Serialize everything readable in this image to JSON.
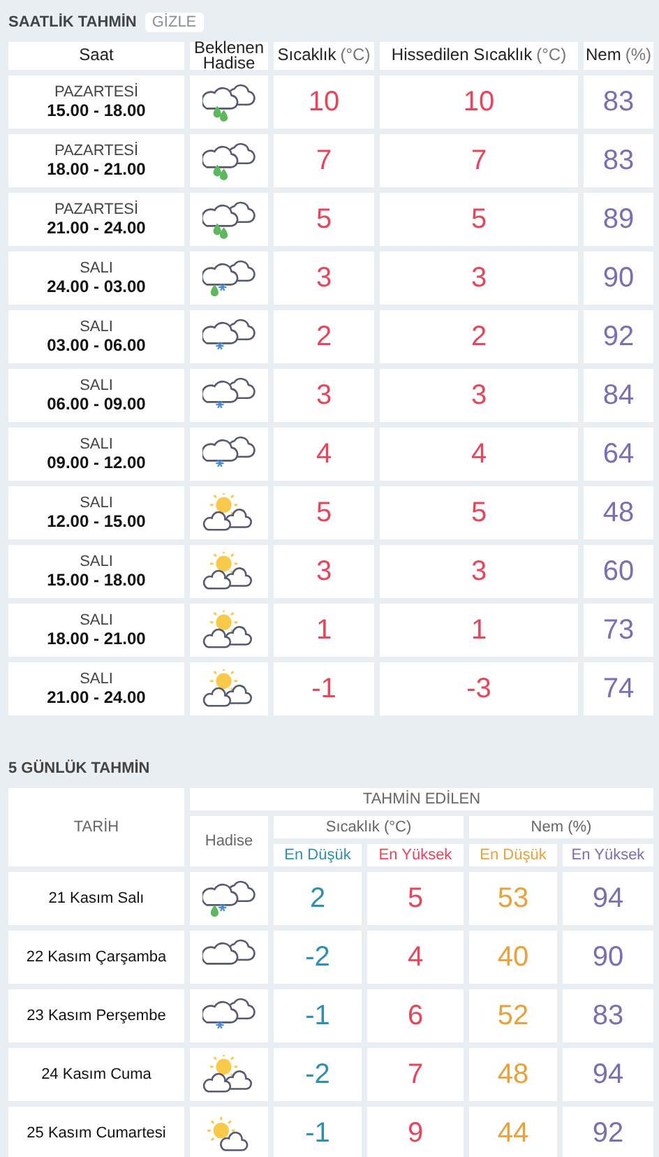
{
  "hourly": {
    "title": "SAATLİK TAHMİN",
    "hide_button": "GİZLE",
    "columns": [
      {
        "label": "Saat"
      },
      {
        "label": "Beklenen Hadise"
      },
      {
        "label": "Sıcaklık",
        "unit": "(°C)"
      },
      {
        "label": "Hissedilen Sıcaklık",
        "unit": "(°C)"
      },
      {
        "label": "Nem",
        "unit": "(%)"
      }
    ],
    "rows": [
      {
        "day": "PAZARTESİ",
        "time": "15.00 - 18.00",
        "kind": "rain",
        "temp": "10",
        "feels": "10",
        "humidity": "83"
      },
      {
        "day": "PAZARTESİ",
        "time": "18.00 - 21.00",
        "kind": "rain",
        "temp": "7",
        "feels": "7",
        "humidity": "83"
      },
      {
        "day": "PAZARTESİ",
        "time": "21.00 - 24.00",
        "kind": "rain",
        "temp": "5",
        "feels": "5",
        "humidity": "89"
      },
      {
        "day": "SALI",
        "time": "24.00 - 03.00",
        "kind": "sleet",
        "temp": "3",
        "feels": "3",
        "humidity": "90"
      },
      {
        "day": "SALI",
        "time": "03.00 - 06.00",
        "kind": "snow",
        "temp": "2",
        "feels": "2",
        "humidity": "92"
      },
      {
        "day": "SALI",
        "time": "06.00 - 09.00",
        "kind": "snow",
        "temp": "3",
        "feels": "3",
        "humidity": "84"
      },
      {
        "day": "SALI",
        "time": "09.00 - 12.00",
        "kind": "snow",
        "temp": "4",
        "feels": "4",
        "humidity": "64"
      },
      {
        "day": "SALI",
        "time": "12.00 - 15.00",
        "kind": "suncloud",
        "temp": "5",
        "feels": "5",
        "humidity": "48"
      },
      {
        "day": "SALI",
        "time": "15.00 - 18.00",
        "kind": "suncloud",
        "temp": "3",
        "feels": "3",
        "humidity": "60"
      },
      {
        "day": "SALI",
        "time": "18.00 - 21.00",
        "kind": "suncloud",
        "temp": "1",
        "feels": "1",
        "humidity": "73"
      },
      {
        "day": "SALI",
        "time": "21.00 - 24.00",
        "kind": "suncloud",
        "temp": "-1",
        "feels": "-3",
        "humidity": "74"
      }
    ]
  },
  "daily": {
    "title": "5 GÜNLÜK TAHMİN",
    "date_header": "TARİH",
    "group_header": "TAHMİN EDİLEN",
    "icon_header": "Hadise",
    "groups": [
      {
        "label": "Sıcaklık (°C)",
        "columns": [
          {
            "label": "En Düşük",
            "color": "#2f8fb3"
          },
          {
            "label": "En Yüksek",
            "color": "#e8445a"
          }
        ]
      },
      {
        "label": "Nem (%)",
        "columns": [
          {
            "label": "En Düşük",
            "color": "#e9a13b"
          },
          {
            "label": "En Yüksek",
            "color": "#7a6fb0"
          }
        ]
      }
    ],
    "rows": [
      {
        "date": "21 Kasım Salı",
        "kind": "sleet",
        "values": [
          "2",
          "5",
          "53",
          "94"
        ]
      },
      {
        "date": "22 Kasım Çarşamba",
        "kind": "cloudy",
        "values": [
          "-2",
          "4",
          "40",
          "90"
        ]
      },
      {
        "date": "23 Kasım Perşembe",
        "kind": "snow",
        "values": [
          "-1",
          "6",
          "52",
          "83"
        ]
      },
      {
        "date": "24 Kasım Cuma",
        "kind": "suncloud",
        "values": [
          "-2",
          "7",
          "48",
          "94"
        ]
      },
      {
        "date": "25 Kasım Cumartesi",
        "kind": "sunny",
        "values": [
          "-1",
          "9",
          "44",
          "92"
        ]
      }
    ]
  }
}
